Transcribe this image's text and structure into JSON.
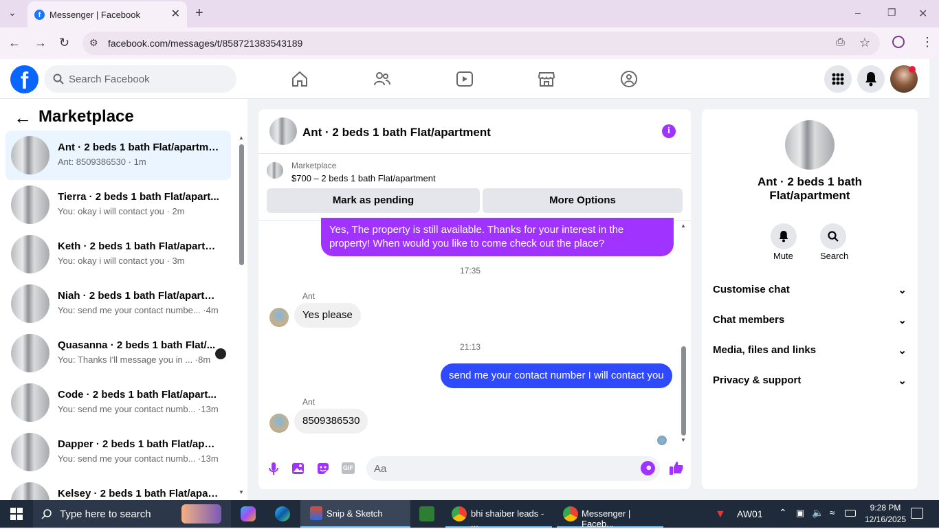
{
  "browser": {
    "tab_title": "Messenger | Facebook",
    "url": "facebook.com/messages/t/858721383543189"
  },
  "fb": {
    "search_placeholder": "Search Facebook"
  },
  "left": {
    "title": "Marketplace",
    "conversations": [
      {
        "name": "Ant · 2 beds 1 bath Flat/apartment",
        "preview": "Ant: 8509386530",
        "time": "1m",
        "selected": true
      },
      {
        "name": "Tierra · 2 beds 1 bath Flat/apart...",
        "preview": "You: okay i will contact you",
        "time": "2m"
      },
      {
        "name": "Keth · 2 beds 1 bath Flat/apartm...",
        "preview": "You: okay i will contact you",
        "time": "3m"
      },
      {
        "name": "Niah · 2 beds 1 bath Flat/apartm...",
        "preview": "You: send me your contact numbe...",
        "time": "4m"
      },
      {
        "name": "Quasanna · 2 beds 1 bath Flat/...",
        "preview": "You: Thanks I'll message you in ...",
        "time": "8m"
      },
      {
        "name": "Code · 2 beds 1 bath Flat/apart...",
        "preview": "You: send me your contact numb...",
        "time": "13m"
      },
      {
        "name": "Dapper · 2 beds 1 bath Flat/apar...",
        "preview": "You: send me your contact numb...",
        "time": "13m"
      },
      {
        "name": "Kelsey · 2 beds 1 bath Flat/apart...",
        "preview": "",
        "time": ""
      }
    ]
  },
  "chat": {
    "title": "Ant · 2 beds 1 bath Flat/apartment",
    "listing_label": "Marketplace",
    "listing_text": "$700 – 2 beds 1 bath Flat/apartment",
    "mark_pending": "Mark as pending",
    "more_options": "More Options",
    "messages": {
      "m1": "Yes, The property is still available. Thanks for your interest in the property! When would you like to come check out the place?",
      "ts1": "17:35",
      "sender1": "Ant",
      "m2": "Yes please",
      "ts2": "21:13",
      "m3": "send me your contact number I will contact you",
      "sender2": "Ant",
      "m4": "8509386530"
    },
    "composer_placeholder": "Aa"
  },
  "right": {
    "name": "Ant · 2 beds 1 bath Flat/apartment",
    "mute": "Mute",
    "search": "Search",
    "sections": [
      "Customise chat",
      "Chat members",
      "Media, files and links",
      "Privacy & support"
    ]
  },
  "taskbar": {
    "search_placeholder": "Type here to search",
    "apps": [
      "Snip & Sketch",
      "bhi shaiber leads - ...",
      "Messenger | Faceb..."
    ],
    "tray_label": "AW01",
    "time": "9:28 PM",
    "date": "12/16/2025"
  },
  "colors": {
    "accent": "#a033ff",
    "fb_blue": "#0866ff"
  }
}
